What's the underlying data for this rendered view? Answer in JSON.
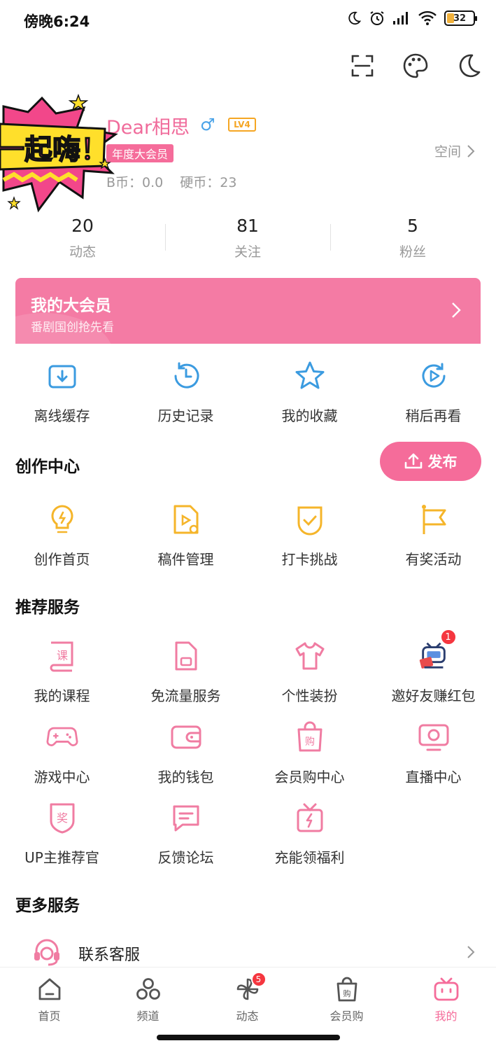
{
  "status_bar": {
    "time": "傍晚6:24",
    "battery": "32"
  },
  "profile": {
    "username": "Dear相思",
    "gender_symbol": "♂",
    "level": "LV4",
    "vip_badge": "年度大会员",
    "b_coins": "B币：0.0",
    "hard_coins": "硬币：23",
    "space_link": "空间"
  },
  "sticker": {
    "text": "一起嗨！"
  },
  "stats": [
    {
      "value": "20",
      "label": "动态"
    },
    {
      "value": "81",
      "label": "关注"
    },
    {
      "value": "5",
      "label": "粉丝"
    }
  ],
  "vip_banner": {
    "title": "我的大会员",
    "subtitle": "番剧国创抢先看"
  },
  "quick_actions": [
    {
      "label": "离线缓存",
      "icon": "offline-cache-icon"
    },
    {
      "label": "历史记录",
      "icon": "history-icon"
    },
    {
      "label": "我的收藏",
      "icon": "star-icon"
    },
    {
      "label": "稍后再看",
      "icon": "watch-later-icon"
    }
  ],
  "creation": {
    "title": "创作中心",
    "publish_label": "发布",
    "items": [
      {
        "label": "创作首页",
        "icon": "bulb-icon"
      },
      {
        "label": "稿件管理",
        "icon": "manuscript-icon"
      },
      {
        "label": "打卡挑战",
        "icon": "checkin-icon"
      },
      {
        "label": "有奖活动",
        "icon": "flag-icon"
      }
    ]
  },
  "recommended": {
    "title": "推荐服务",
    "items": [
      {
        "label": "我的课程",
        "icon": "course-icon"
      },
      {
        "label": "免流量服务",
        "icon": "sim-card-icon"
      },
      {
        "label": "个性装扮",
        "icon": "tshirt-icon"
      },
      {
        "label": "邀好友赚红包",
        "icon": "invite-mascot-icon",
        "badge": "1"
      },
      {
        "label": "游戏中心",
        "icon": "gamepad-icon"
      },
      {
        "label": "我的钱包",
        "icon": "wallet-icon"
      },
      {
        "label": "会员购中心",
        "icon": "shopping-bag-icon"
      },
      {
        "label": "直播中心",
        "icon": "live-tv-icon"
      },
      {
        "label": "UP主推荐官",
        "icon": "award-shield-icon"
      },
      {
        "label": "反馈论坛",
        "icon": "feedback-icon"
      },
      {
        "label": "充能领福利",
        "icon": "gift-icon"
      }
    ]
  },
  "more_services": {
    "title": "更多服务",
    "contact_label": "联系客服"
  },
  "bottom_nav": [
    {
      "label": "首页",
      "icon": "home-icon"
    },
    {
      "label": "频道",
      "icon": "channel-icon"
    },
    {
      "label": "动态",
      "icon": "dynamic-icon",
      "badge": "5"
    },
    {
      "label": "会员购",
      "icon": "shop-icon"
    },
    {
      "label": "我的",
      "icon": "mine-tv-icon",
      "active": true
    }
  ],
  "colors": {
    "accent_pink": "#f56c9a",
    "blue_icon": "#3b9be0",
    "yellow_icon": "#f5b52a",
    "badge_red": "#f5363f"
  }
}
